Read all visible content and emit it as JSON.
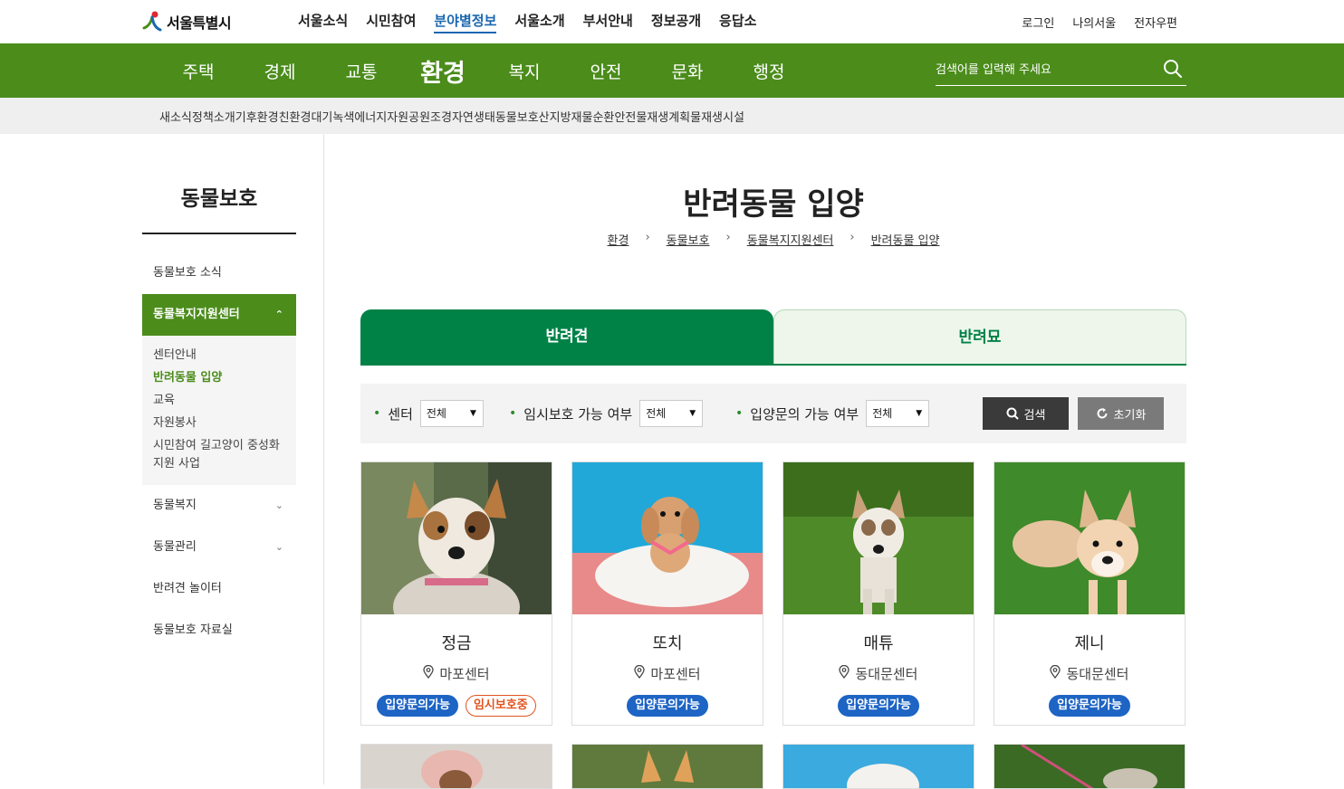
{
  "header": {
    "logo_text": "서울특별시",
    "top_nav": [
      "서울소식",
      "시민참여",
      "분야별정보",
      "서울소개",
      "부서안내",
      "정보공개",
      "응답소"
    ],
    "top_nav_active": "분야별정보",
    "util_links": [
      "로그인",
      "나의서울",
      "전자우편"
    ]
  },
  "green_nav": {
    "items": [
      "주택",
      "경제",
      "교통",
      "환경",
      "복지",
      "안전",
      "문화",
      "행정"
    ],
    "active": "환경",
    "search_placeholder": "검색어를 입력해 주세요"
  },
  "sub_nav": [
    "새소식",
    "정책소개",
    "기후환경",
    "친환경",
    "대기",
    "녹색에너지",
    "자원",
    "공원",
    "조경",
    "자연생태",
    "동물보호",
    "산지방재",
    "물순환안전",
    "물재생계획",
    "물재생시설"
  ],
  "sidebar": {
    "title": "동물보호",
    "items": [
      {
        "label": "동물보호 소식"
      },
      {
        "label": "동물복지지원센터",
        "expanded": true
      },
      {
        "label": "동물복지",
        "chevron": "down"
      },
      {
        "label": "동물관리",
        "chevron": "down"
      },
      {
        "label": "반려견 놀이터"
      },
      {
        "label": "동물보호 자료실"
      }
    ],
    "sub_items": [
      "센터안내",
      "반려동물 입양",
      "교육",
      "자원봉사",
      "시민참여 길고양이 중성화 지원 사업"
    ],
    "sub_active": "반려동물 입양"
  },
  "main": {
    "title": "반려동물 입양",
    "breadcrumb": [
      "환경",
      "동물보호",
      "동물복지지원센터",
      "반려동물 입양"
    ],
    "tabs": [
      {
        "label": "반려견",
        "active": true
      },
      {
        "label": "반려묘",
        "active": false
      }
    ],
    "filters": [
      {
        "label": "센터",
        "value": "전체"
      },
      {
        "label": "임시보호 가능 여부",
        "value": "전체"
      },
      {
        "label": "입양문의 가능 여부",
        "value": "전체"
      }
    ],
    "search_button": "검색",
    "reset_button": "초기화",
    "cards": [
      {
        "name": "정금",
        "center": "마포센터",
        "badges": [
          {
            "text": "입양문의가능",
            "style": "blue"
          },
          {
            "text": "임시보호중",
            "style": "orange"
          }
        ]
      },
      {
        "name": "또치",
        "center": "마포센터",
        "badges": [
          {
            "text": "입양문의가능",
            "style": "blue"
          }
        ]
      },
      {
        "name": "매튜",
        "center": "동대문센터",
        "badges": [
          {
            "text": "입양문의가능",
            "style": "blue"
          }
        ]
      },
      {
        "name": "제니",
        "center": "동대문센터",
        "badges": [
          {
            "text": "입양문의가능",
            "style": "blue"
          }
        ]
      }
    ]
  },
  "colors": {
    "brand_green": "#4b8c1b",
    "tab_green": "#008247",
    "badge_blue": "#1d64c4",
    "badge_orange": "#e0541e"
  }
}
